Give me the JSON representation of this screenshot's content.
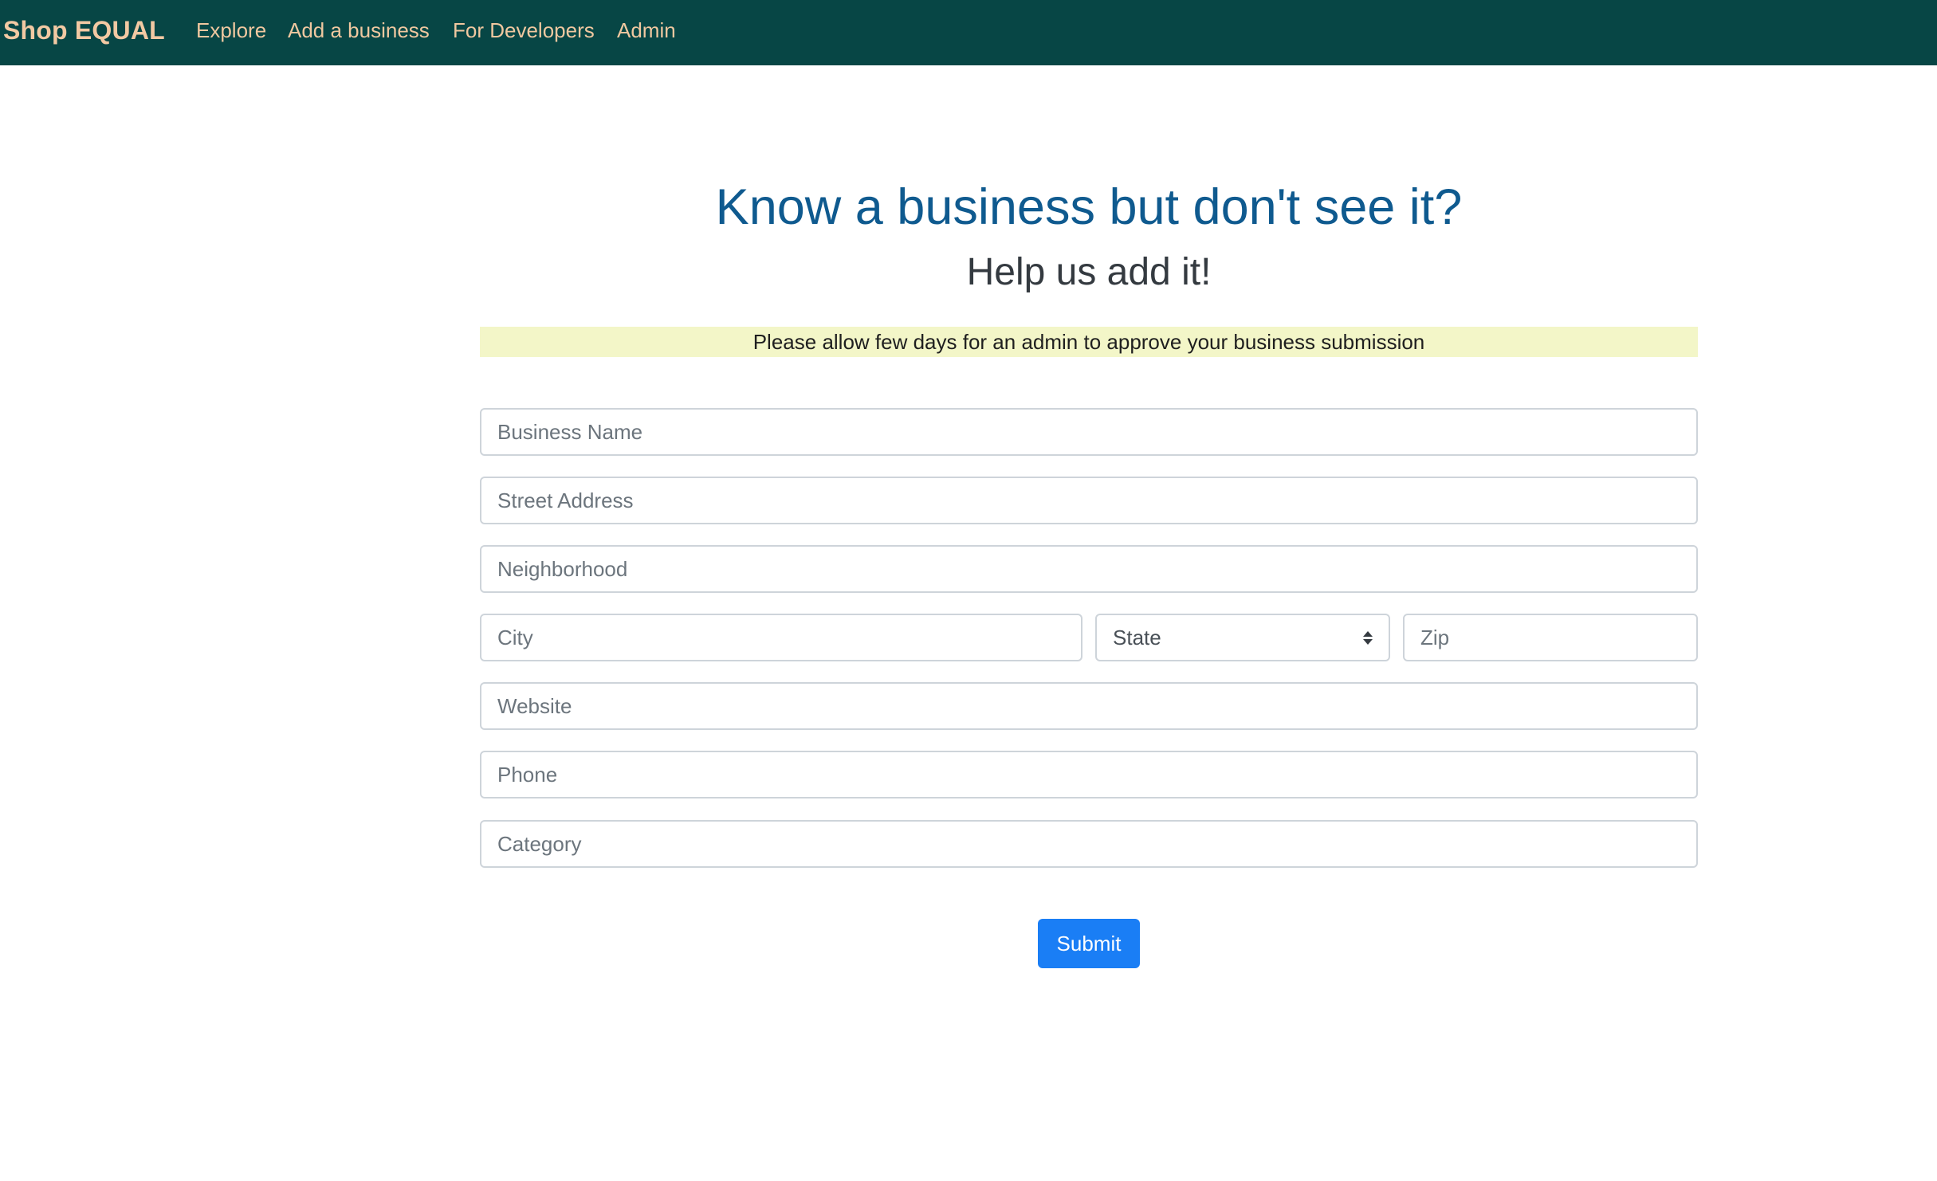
{
  "nav": {
    "brand": "Shop EQUAL",
    "links": [
      "Explore",
      "Add a business",
      "For Developers",
      "Admin"
    ]
  },
  "heading": {
    "title": "Know a business but don't see it?",
    "subtitle": "Help us add it!",
    "notice": "Please allow few days for an admin to approve your business submission"
  },
  "form": {
    "business_name_placeholder": "Business Name",
    "street_address_placeholder": "Street Address",
    "neighborhood_placeholder": "Neighborhood",
    "city_placeholder": "City",
    "state_selected": "State",
    "zip_placeholder": "Zip",
    "website_placeholder": "Website",
    "phone_placeholder": "Phone",
    "category_placeholder": "Category",
    "submit_label": "Submit"
  },
  "colors": {
    "navbar_bg": "#074645",
    "brand_text": "#f2c9a3",
    "title_text": "#0f5a8f",
    "notice_bg": "#f3f6c8",
    "submit_bg": "#1a7ef5"
  }
}
